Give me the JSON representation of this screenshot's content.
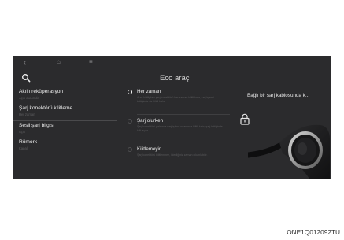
{
  "nav": {
    "back_icon": "back-chevron-icon",
    "home_icon": "home-icon",
    "menu_icon": "menu-icon"
  },
  "search_icon": "search-icon",
  "title": "Eco araç",
  "menu": [
    {
      "label": "Akıllı reküperasyon",
      "sub": "Açık durumda"
    },
    {
      "label": "Şarj konektörü kilitleme",
      "sub": "Her zaman"
    },
    {
      "label": "Sesli şarj bilgisi",
      "sub": "Açık"
    },
    {
      "label": "Römork",
      "sub": "Kapalı"
    }
  ],
  "options": [
    {
      "label": "Her zaman",
      "selected": true,
      "desc": "Araç kilitliyken şarj konektörü her zaman kilitli kalır, şarj işlemi bittiğinde de kilitli kalır."
    },
    {
      "label": "Şarj olurken",
      "selected": false,
      "desc": "Şarj konektörü yalnızca şarj işlemi sırasında kilitli kalır, şarj bittiğinde kilit açılır."
    },
    {
      "label": "Kilitlemeyin",
      "selected": false,
      "desc": "Şarj konektörü kilitlenmez, istediğiniz zaman çıkarılabilir."
    }
  ],
  "info": {
    "text": "Bağlı bir şarj kablosunda k...",
    "lock_icon": "lock-icon",
    "illustration": "charging-plug-illustration"
  },
  "caption": "ONE1Q012092TU",
  "colors": {
    "screen_bg": "#2b2b2d",
    "text_primary": "#ededed",
    "text_secondary": "#5e5e60",
    "divider": "#4a4a4c"
  }
}
